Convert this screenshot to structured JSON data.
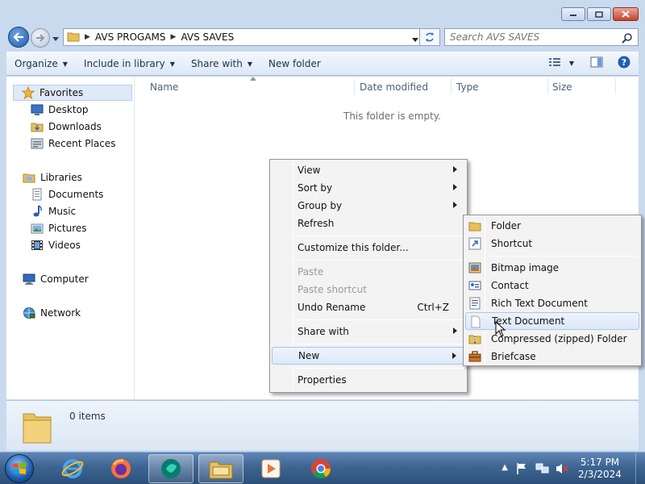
{
  "window": {
    "breadcrumb": [
      "AVS PROGAMS",
      "AVS SAVES"
    ],
    "search_placeholder": "Search AVS SAVES"
  },
  "command_bar": {
    "organize": "Organize",
    "include_in_library": "Include in library",
    "share_with": "Share with",
    "new_folder": "New folder"
  },
  "nav": {
    "favorites": "Favorites",
    "desktop": "Desktop",
    "downloads": "Downloads",
    "recent_places": "Recent Places",
    "libraries": "Libraries",
    "documents": "Documents",
    "music": "Music",
    "pictures": "Pictures",
    "videos": "Videos",
    "computer": "Computer",
    "network": "Network"
  },
  "columns": {
    "name": "Name",
    "date_modified": "Date modified",
    "type": "Type",
    "size": "Size"
  },
  "content": {
    "empty_message": "This folder is empty."
  },
  "details": {
    "item_count": "0 items"
  },
  "context_menu": {
    "view": "View",
    "sort_by": "Sort by",
    "group_by": "Group by",
    "refresh": "Refresh",
    "customize": "Customize this folder...",
    "paste": "Paste",
    "paste_shortcut": "Paste shortcut",
    "undo_rename": "Undo Rename",
    "undo_accel": "Ctrl+Z",
    "share_with": "Share with",
    "new": "New",
    "properties": "Properties"
  },
  "new_submenu": {
    "folder": "Folder",
    "shortcut": "Shortcut",
    "bitmap": "Bitmap image",
    "contact": "Contact",
    "rich_text": "Rich Text Document",
    "text_document": "Text Document",
    "compressed": "Compressed (zipped) Folder",
    "briefcase": "Briefcase"
  },
  "taskbar": {
    "time": "5:17 PM",
    "date": "2/3/2024"
  },
  "colors": {
    "accent": "#1f5fb3",
    "highlight": "#dce8f8"
  }
}
